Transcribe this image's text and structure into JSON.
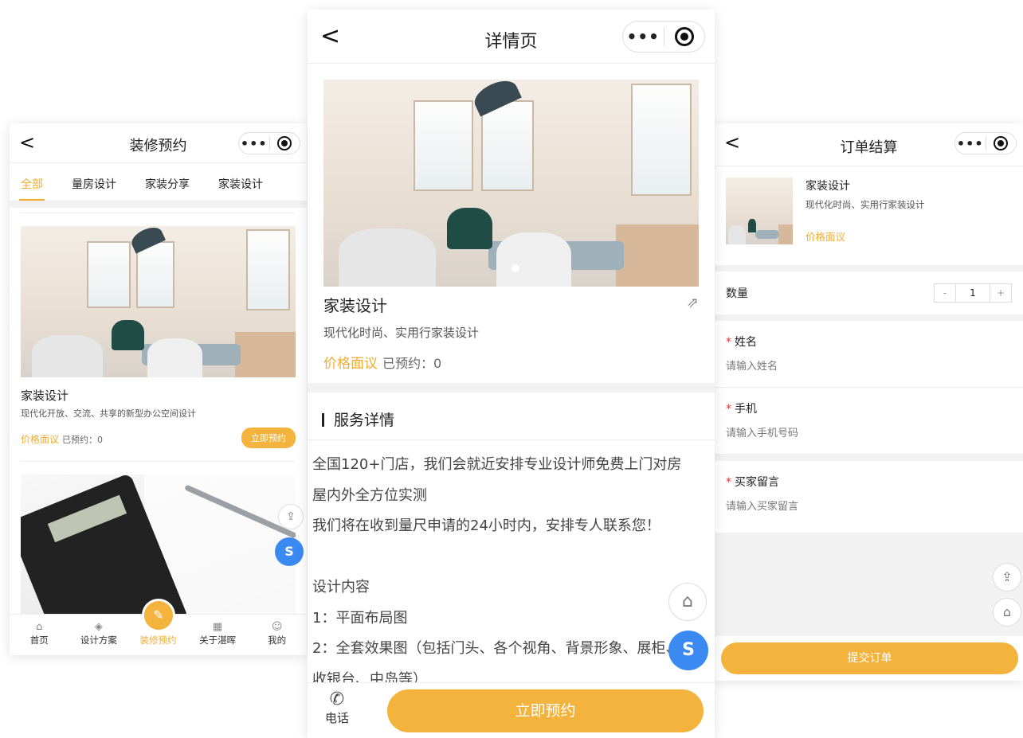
{
  "phone1": {
    "nav": {
      "back": "<",
      "title": "装修预约",
      "menu": "•••"
    },
    "tabs": [
      "全部",
      "量房设计",
      "家装分享",
      "家装设计"
    ],
    "card1": {
      "title": "家装设计",
      "subtitle": "现代化开放、交流、共享的新型办公空间设计",
      "price": "价格面议",
      "booked": "已预约：0",
      "button": "立即预约"
    },
    "tabbar": [
      {
        "label": "首页",
        "icon": "⌂"
      },
      {
        "label": "设计方案",
        "icon": "◈"
      },
      {
        "label": "装修预约",
        "icon": "✎"
      },
      {
        "label": "关于湛晖",
        "icon": "▦"
      },
      {
        "label": "我的",
        "icon": "☺"
      }
    ]
  },
  "phone2": {
    "nav": {
      "back": "<",
      "title": "详情页",
      "menu": "•••"
    },
    "product": {
      "title": "家装设计",
      "subtitle": "现代化时尚、实用行家装设计",
      "price": "价格面议",
      "booked": "已预约：0"
    },
    "service": {
      "heading": "服务详情",
      "lines": [
        "全国120+门店，我们会就近安排专业设计师免费上门对房",
        "屋内外全方位实测",
        "我们将在收到量尺申请的24小时内，安排专人联系您！",
        "",
        "设计内容",
        "1：平面布局图",
        "2：全套效果图（包括门头、各个视角、背景形象、展柜、",
        "收银台、中岛等）"
      ]
    },
    "bottom": {
      "phone_label": "电话",
      "book_label": "立即预约"
    }
  },
  "phone3": {
    "nav": {
      "back": "<",
      "title": "订单结算",
      "menu": "•••"
    },
    "item": {
      "title": "家装设计",
      "subtitle": "现代化时尚、实用行家装设计",
      "price": "价格面议"
    },
    "quantity": {
      "label": "数量",
      "minus": "-",
      "value": "1",
      "plus": "+"
    },
    "fields": [
      {
        "label": "姓名",
        "placeholder": "请输入姓名"
      },
      {
        "label": "手机",
        "placeholder": "请输入手机号码"
      },
      {
        "label": "买家留言",
        "placeholder": "请输入买家留言"
      }
    ],
    "required_mark": "*",
    "submit": "提交订单"
  },
  "colors": {
    "accent": "#f3b33c",
    "blue": "#3a8af2"
  }
}
